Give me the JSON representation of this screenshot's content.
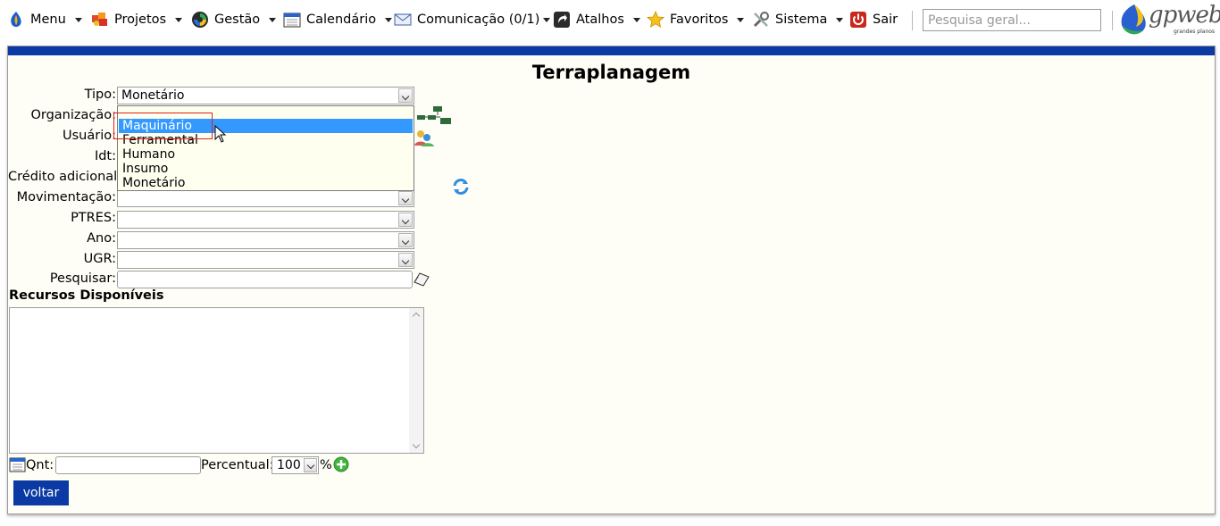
{
  "menu": {
    "items": [
      {
        "label": "Menu",
        "icon": "globe-icon"
      },
      {
        "label": "Projetos",
        "icon": "puzzle-icon"
      },
      {
        "label": "Gestão",
        "icon": "cycle-icon"
      },
      {
        "label": "Calendário",
        "icon": "calendar-icon"
      },
      {
        "label": "Comunicação (0/1)",
        "icon": "envelope-icon"
      },
      {
        "label": "Atalhos",
        "icon": "shortcut-icon"
      },
      {
        "label": "Favoritos",
        "icon": "star-icon"
      },
      {
        "label": "Sistema",
        "icon": "tools-icon"
      }
    ],
    "exit_label": "Sair",
    "search_placeholder": "Pesquisa geral..."
  },
  "logo": {
    "word": "gpweb",
    "tagline": "grandes planos"
  },
  "page": {
    "title": "Terraplanagem"
  },
  "form": {
    "tipo_label": "Tipo:",
    "tipo_value": "Monetário",
    "organizacao_label": "Organização:",
    "usuario_label": "Usuário:",
    "idt_label": "Idt:",
    "credito_label": "Crédito adicional:",
    "movimentacao_label": "Movimentação:",
    "ptres_label": "PTRES:",
    "ano_label": "Ano:",
    "ugr_label": "UGR:",
    "pesquisar_label": "Pesquisar:"
  },
  "tipo_dropdown": {
    "options": [
      "Maquinário",
      "Ferramental",
      "Humano",
      "Insumo",
      "Monetário"
    ],
    "highlighted": "Maquinário"
  },
  "recursos": {
    "title": "Recursos Disponíveis"
  },
  "footer": {
    "qnt_label": "Qnt:",
    "percentual_label": "Percentual:",
    "percentual_value": "100",
    "percent_sign": "%",
    "voltar_label": "voltar"
  },
  "colors": {
    "accent": "#0b3aa4",
    "highlight": "#3399ff",
    "marker": "#e0201a"
  }
}
